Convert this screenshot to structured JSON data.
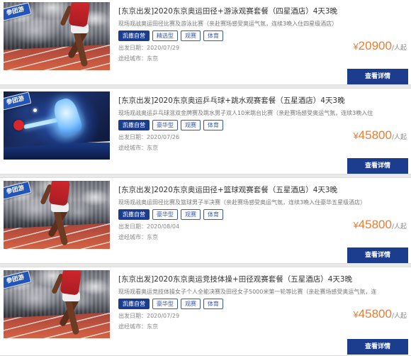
{
  "colors": {
    "accent": "#1c3d8e",
    "tag_outline": "#3558a8",
    "price": "#f07b2c"
  },
  "labels": {
    "badge": "参团游",
    "departure_date": "出发日期：",
    "cities": "途经城市：",
    "price_unit": "/人起",
    "details_button": "查看详情"
  },
  "packages": [
    {
      "title": "[东京出发]2020东京奥运田径+游泳观赛套餐（四星酒店）4天3晚",
      "description": "现场观战奥运田径比赛及游泳比赛（亲赴赛场感受奥运气氛，连续3晚入住四星级酒店）",
      "tags": [
        "凯撒自营",
        "精选型",
        "观赛",
        "体育"
      ],
      "departure_date": "2020/07/29",
      "cities": "东京",
      "currency": "¥",
      "price": "20900"
    },
    {
      "title": "[东京出发]2020东京奥运乒乓球+跳水观赛套餐（五星酒店）4天3晚",
      "description": "现场观战奥运乒乓球混双金牌赛及跳水男子双人10米跳台比赛（亲赴赛场感受奥运气氛，连续3晚入住",
      "tags": [
        "凯撒自营",
        "豪华型",
        "观赛",
        "体育"
      ],
      "departure_date": "2020/07/26",
      "cities": "东京",
      "currency": "¥",
      "price": "45800"
    },
    {
      "title": "[东京出发]2020东京奥运田径+篮球观赛套餐（五星酒店）4天3晚",
      "description": "现场观战奥运田径比赛及篮球男子半决赛（亲赴赛场感受奥运气氛，连续3晚入住豪华五星级酒店）",
      "tags": [
        "凯撒自营",
        "豪华型",
        "观赛",
        "体育"
      ],
      "departure_date": "2020/08/04",
      "cities": "东京",
      "currency": "¥",
      "price": "45800"
    },
    {
      "title": "[东京出发]2020东京奥运竞技体操+田径观赛套餐（五星酒店）4天3晚",
      "description": "现场观看奥运竞技体操女子个人全能决赛及田径女子5000米第一轮等比赛（亲赴赛场感受奥运气氛，连",
      "tags": [
        "凯撒自营",
        "豪华型",
        "观赛",
        "体育"
      ],
      "departure_date": "2020/07/29",
      "cities": "东京",
      "currency": "¥",
      "price": "45800"
    }
  ]
}
